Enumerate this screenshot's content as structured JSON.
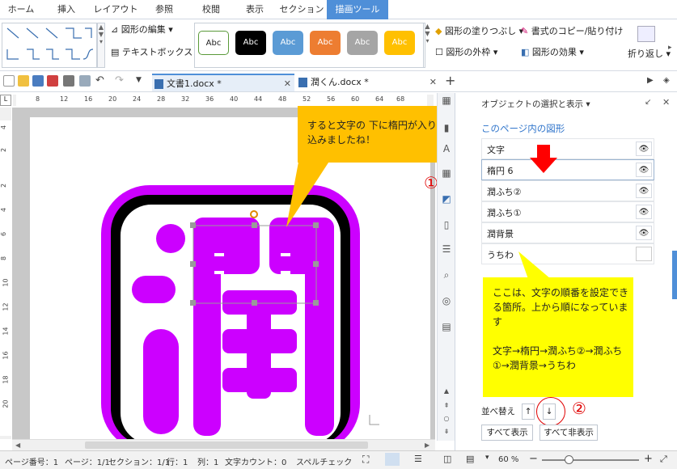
{
  "ribbon_tabs": [
    "ホーム",
    "挿入",
    "レイアウト",
    "参照",
    "校閲",
    "表示",
    "セクション",
    "描画ツール"
  ],
  "ribbon": {
    "edit_shape": "図形の編集",
    "text_box": "テキストボックス",
    "shape_styles": [
      "Abc",
      "Abc",
      "Abc",
      "Abc",
      "Abc",
      "Abc"
    ],
    "fill": "図形の塗りつぶし",
    "outline": "図形の外枠",
    "copy_format": "書式のコピー/貼り付け",
    "effects": "図形の効果",
    "wrap": "折り返し"
  },
  "doc_tabs": [
    {
      "name": "文書1.docx *"
    },
    {
      "name": "潤くん.docx *"
    }
  ],
  "ruler": {
    "h_ticks": [
      "8",
      "12",
      "16",
      "20",
      "24",
      "28",
      "32",
      "36",
      "40",
      "44",
      "48",
      "52",
      "56",
      "60",
      "64",
      "68"
    ],
    "v_ticks": [
      "4",
      "2",
      "2",
      "4",
      "6",
      "8",
      "10",
      "12",
      "14",
      "16",
      "18",
      "20"
    ]
  },
  "callouts": {
    "top": "すると文字の 下に楕円が入り込みましたね！",
    "right": "ここは、文字の順番を設定できる箇所。上から順になっています\n\n文字→楕円→潤ふち②→潤ふち①→潤背景→うちわ",
    "marker1": "①",
    "marker2": "②"
  },
  "panel": {
    "title": "オブジェクトの選択と表示",
    "subtitle": "このページ内の図形",
    "objects": [
      "文字",
      "楕円 6",
      "潤ふち②",
      "潤ふち①",
      "潤背景",
      "うちわ"
    ],
    "reorder_label": "並べ替え",
    "show_all": "すべて表示",
    "hide_all": "すべて非表示"
  },
  "status": {
    "page_no": "ページ番号：1",
    "page": "ページ：1/1",
    "section": "セクション：1/1",
    "line": "行：1",
    "col": "列：1",
    "char_count": "文字カウント：0",
    "spell": "スペルチェック",
    "zoom": "60 %"
  },
  "colors": {
    "accent": "#4f8fd8",
    "kanji_fill": "#cc00ff",
    "callout_orange": "#ffc000",
    "callout_yellow": "#ffff00",
    "arrow_red": "#ff0000"
  }
}
